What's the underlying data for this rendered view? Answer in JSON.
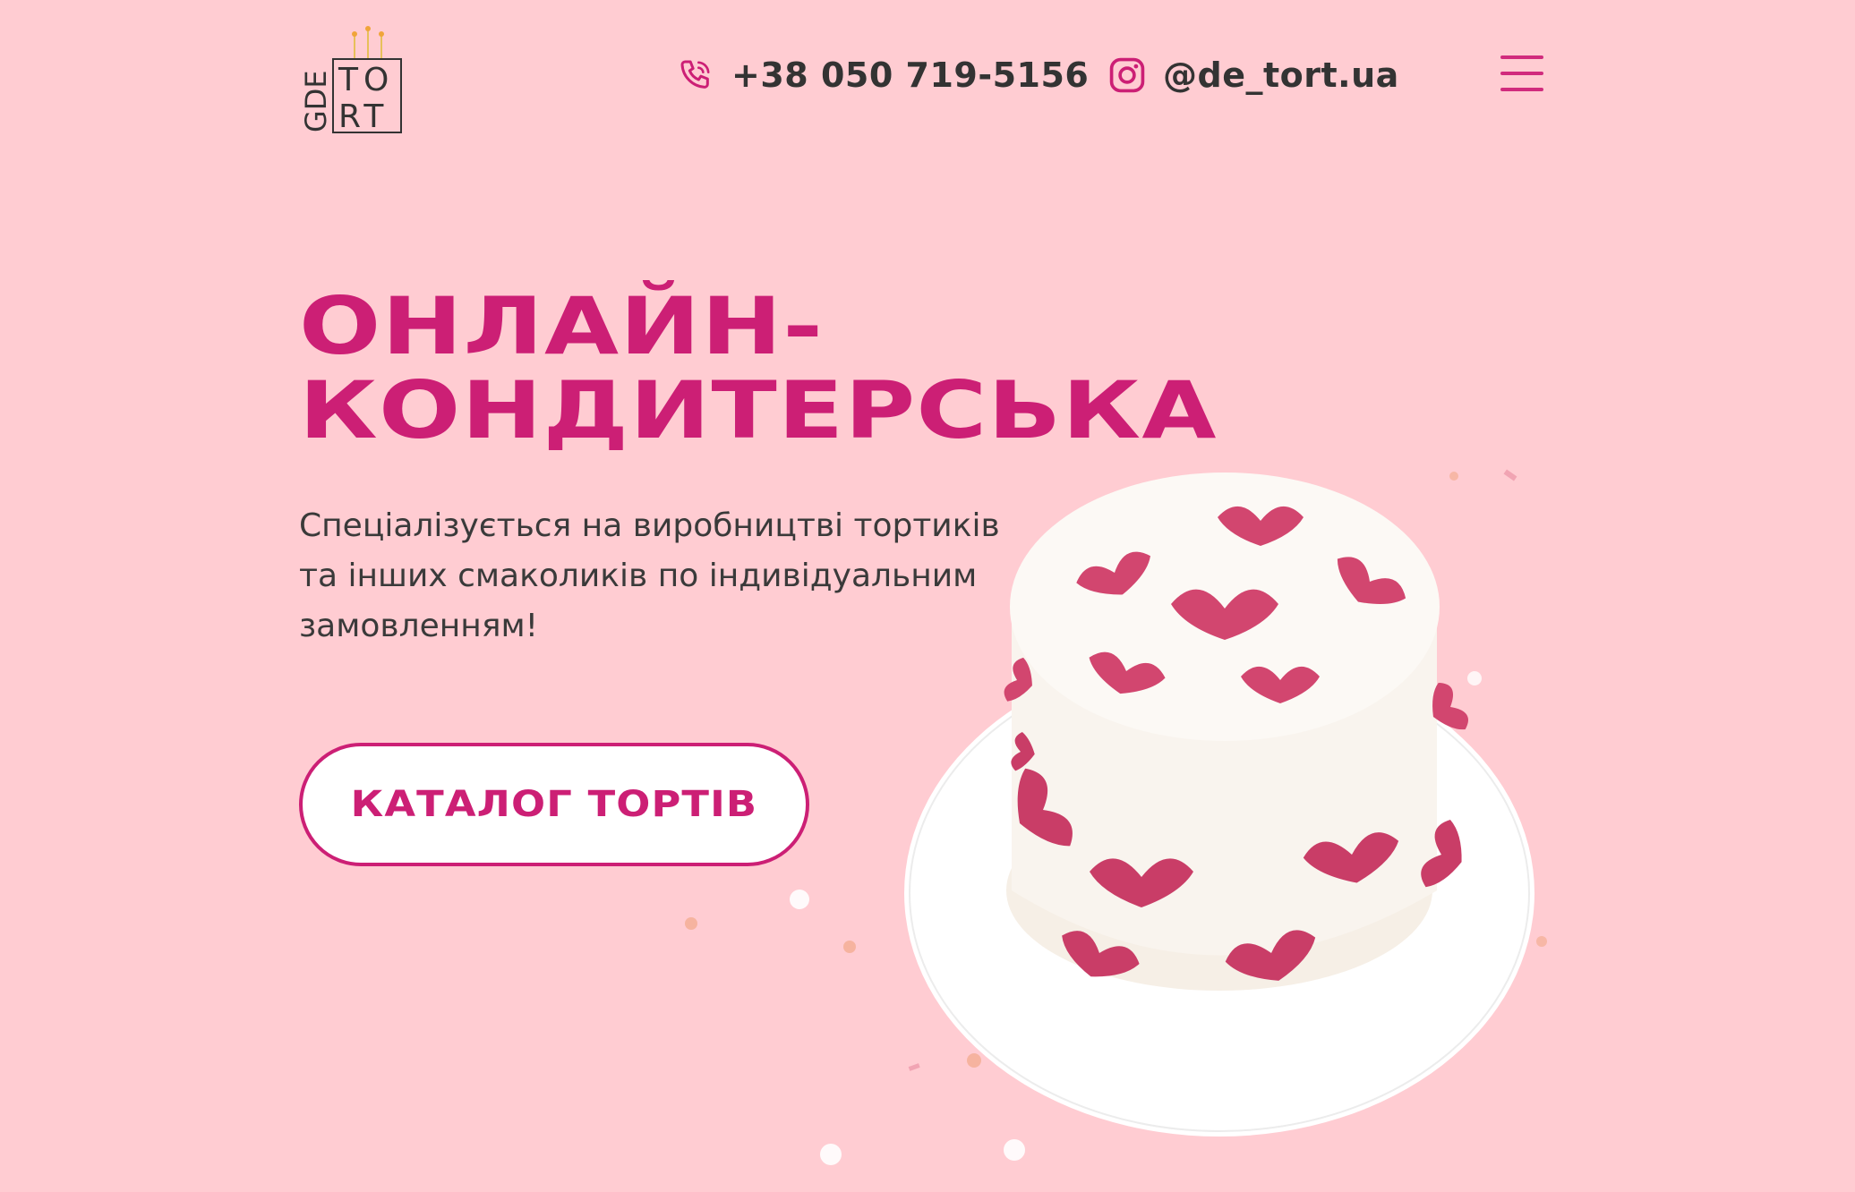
{
  "header": {
    "logo": {
      "letters_left": "GDE",
      "letters_right_top": "TO",
      "letters_right_bottom": "RT"
    },
    "phone": {
      "icon": "phone-icon",
      "text": "+38 050 719-5156"
    },
    "instagram": {
      "icon": "instagram-icon",
      "text": "@de_tort.ua"
    },
    "menu": {
      "icon": "hamburger-menu-icon"
    }
  },
  "hero": {
    "title_line1": "ОНЛАЙН-",
    "title_line2": "КОНДИТЕРСЬКА",
    "subtitle_line1": "Спеціалізується на виробництві тортиків",
    "subtitle_line2": "та інших смаколиків по індивідуальним",
    "subtitle_line3": "замовленням!",
    "cta_label": "КАТАЛОГ ТОРТІВ"
  },
  "colors": {
    "background": "#ffccd2",
    "accent": "#cc1f75",
    "text": "#333333",
    "cake_cream": "#fbf6f1",
    "cake_hearts": "#d2466f"
  }
}
